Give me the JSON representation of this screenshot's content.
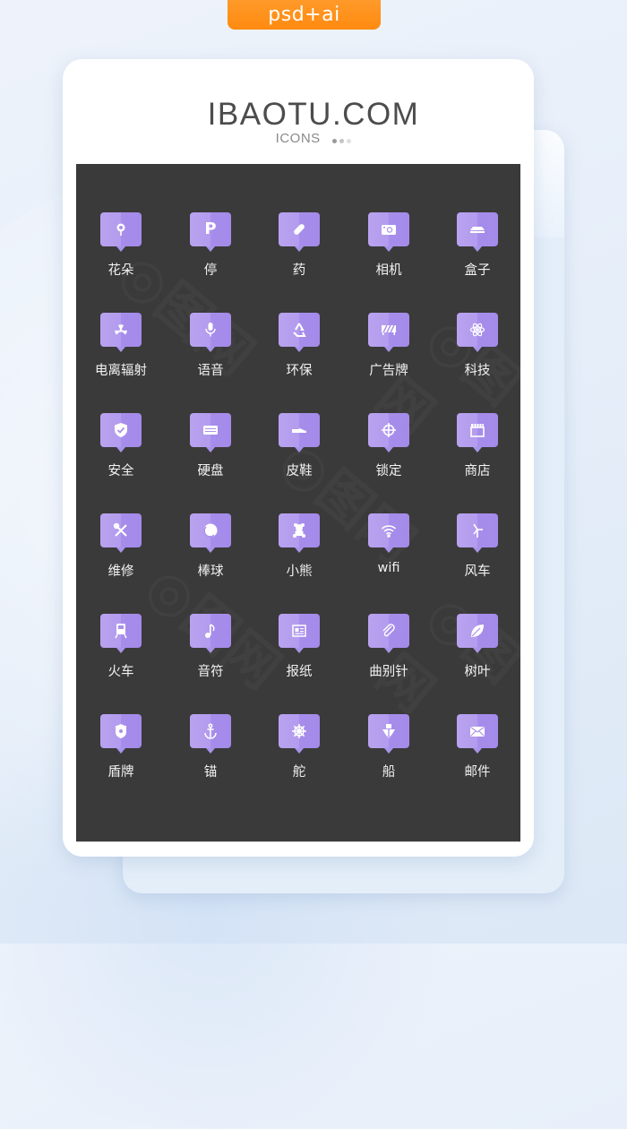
{
  "badge": {
    "label": "psd+ai",
    "color": "#ff8f18"
  },
  "header": {
    "brand": "IBAOTU.COM",
    "subtitle": "ICONS",
    "dot_colors": [
      "#9a9a9a",
      "#c4c4c4",
      "#e0e0e0"
    ]
  },
  "theme": {
    "panel_bg": "#3a3a3a",
    "icon_bg_light": "#b9a3ef",
    "icon_bg_dark": "#a48ae9",
    "label_color": "#f2f2f2"
  },
  "icons": [
    {
      "label": "花朵",
      "icon": "flower-icon"
    },
    {
      "label": "停",
      "icon": "parking-icon",
      "glyph": "P"
    },
    {
      "label": "药",
      "icon": "pill-icon"
    },
    {
      "label": "相机",
      "icon": "camera-icon"
    },
    {
      "label": "盒子",
      "icon": "box-icon"
    },
    {
      "label": "电离辐射",
      "icon": "radiation-icon"
    },
    {
      "label": "语音",
      "icon": "microphone-icon"
    },
    {
      "label": "环保",
      "icon": "recycle-icon"
    },
    {
      "label": "广告牌",
      "icon": "billboard-icon"
    },
    {
      "label": "科技",
      "icon": "atom-icon"
    },
    {
      "label": "安全",
      "icon": "shield-check-icon"
    },
    {
      "label": "硬盘",
      "icon": "hard-drive-icon"
    },
    {
      "label": "皮鞋",
      "icon": "shoe-icon"
    },
    {
      "label": "锁定",
      "icon": "crosshair-icon"
    },
    {
      "label": "商店",
      "icon": "store-icon"
    },
    {
      "label": "维修",
      "icon": "tools-icon"
    },
    {
      "label": "棒球",
      "icon": "baseball-icon"
    },
    {
      "label": "小熊",
      "icon": "bear-icon"
    },
    {
      "label": "wifi",
      "icon": "wifi-icon"
    },
    {
      "label": "风车",
      "icon": "windmill-icon"
    },
    {
      "label": "火车",
      "icon": "train-icon"
    },
    {
      "label": "音符",
      "icon": "music-note-icon"
    },
    {
      "label": "报纸",
      "icon": "newspaper-icon"
    },
    {
      "label": "曲别针",
      "icon": "paperclip-icon"
    },
    {
      "label": "树叶",
      "icon": "leaf-icon"
    },
    {
      "label": "盾牌",
      "icon": "badge-shield-icon"
    },
    {
      "label": "锚",
      "icon": "anchor-icon"
    },
    {
      "label": "舵",
      "icon": "helm-icon"
    },
    {
      "label": "船",
      "icon": "ship-icon"
    },
    {
      "label": "邮件",
      "icon": "mail-icon"
    }
  ]
}
